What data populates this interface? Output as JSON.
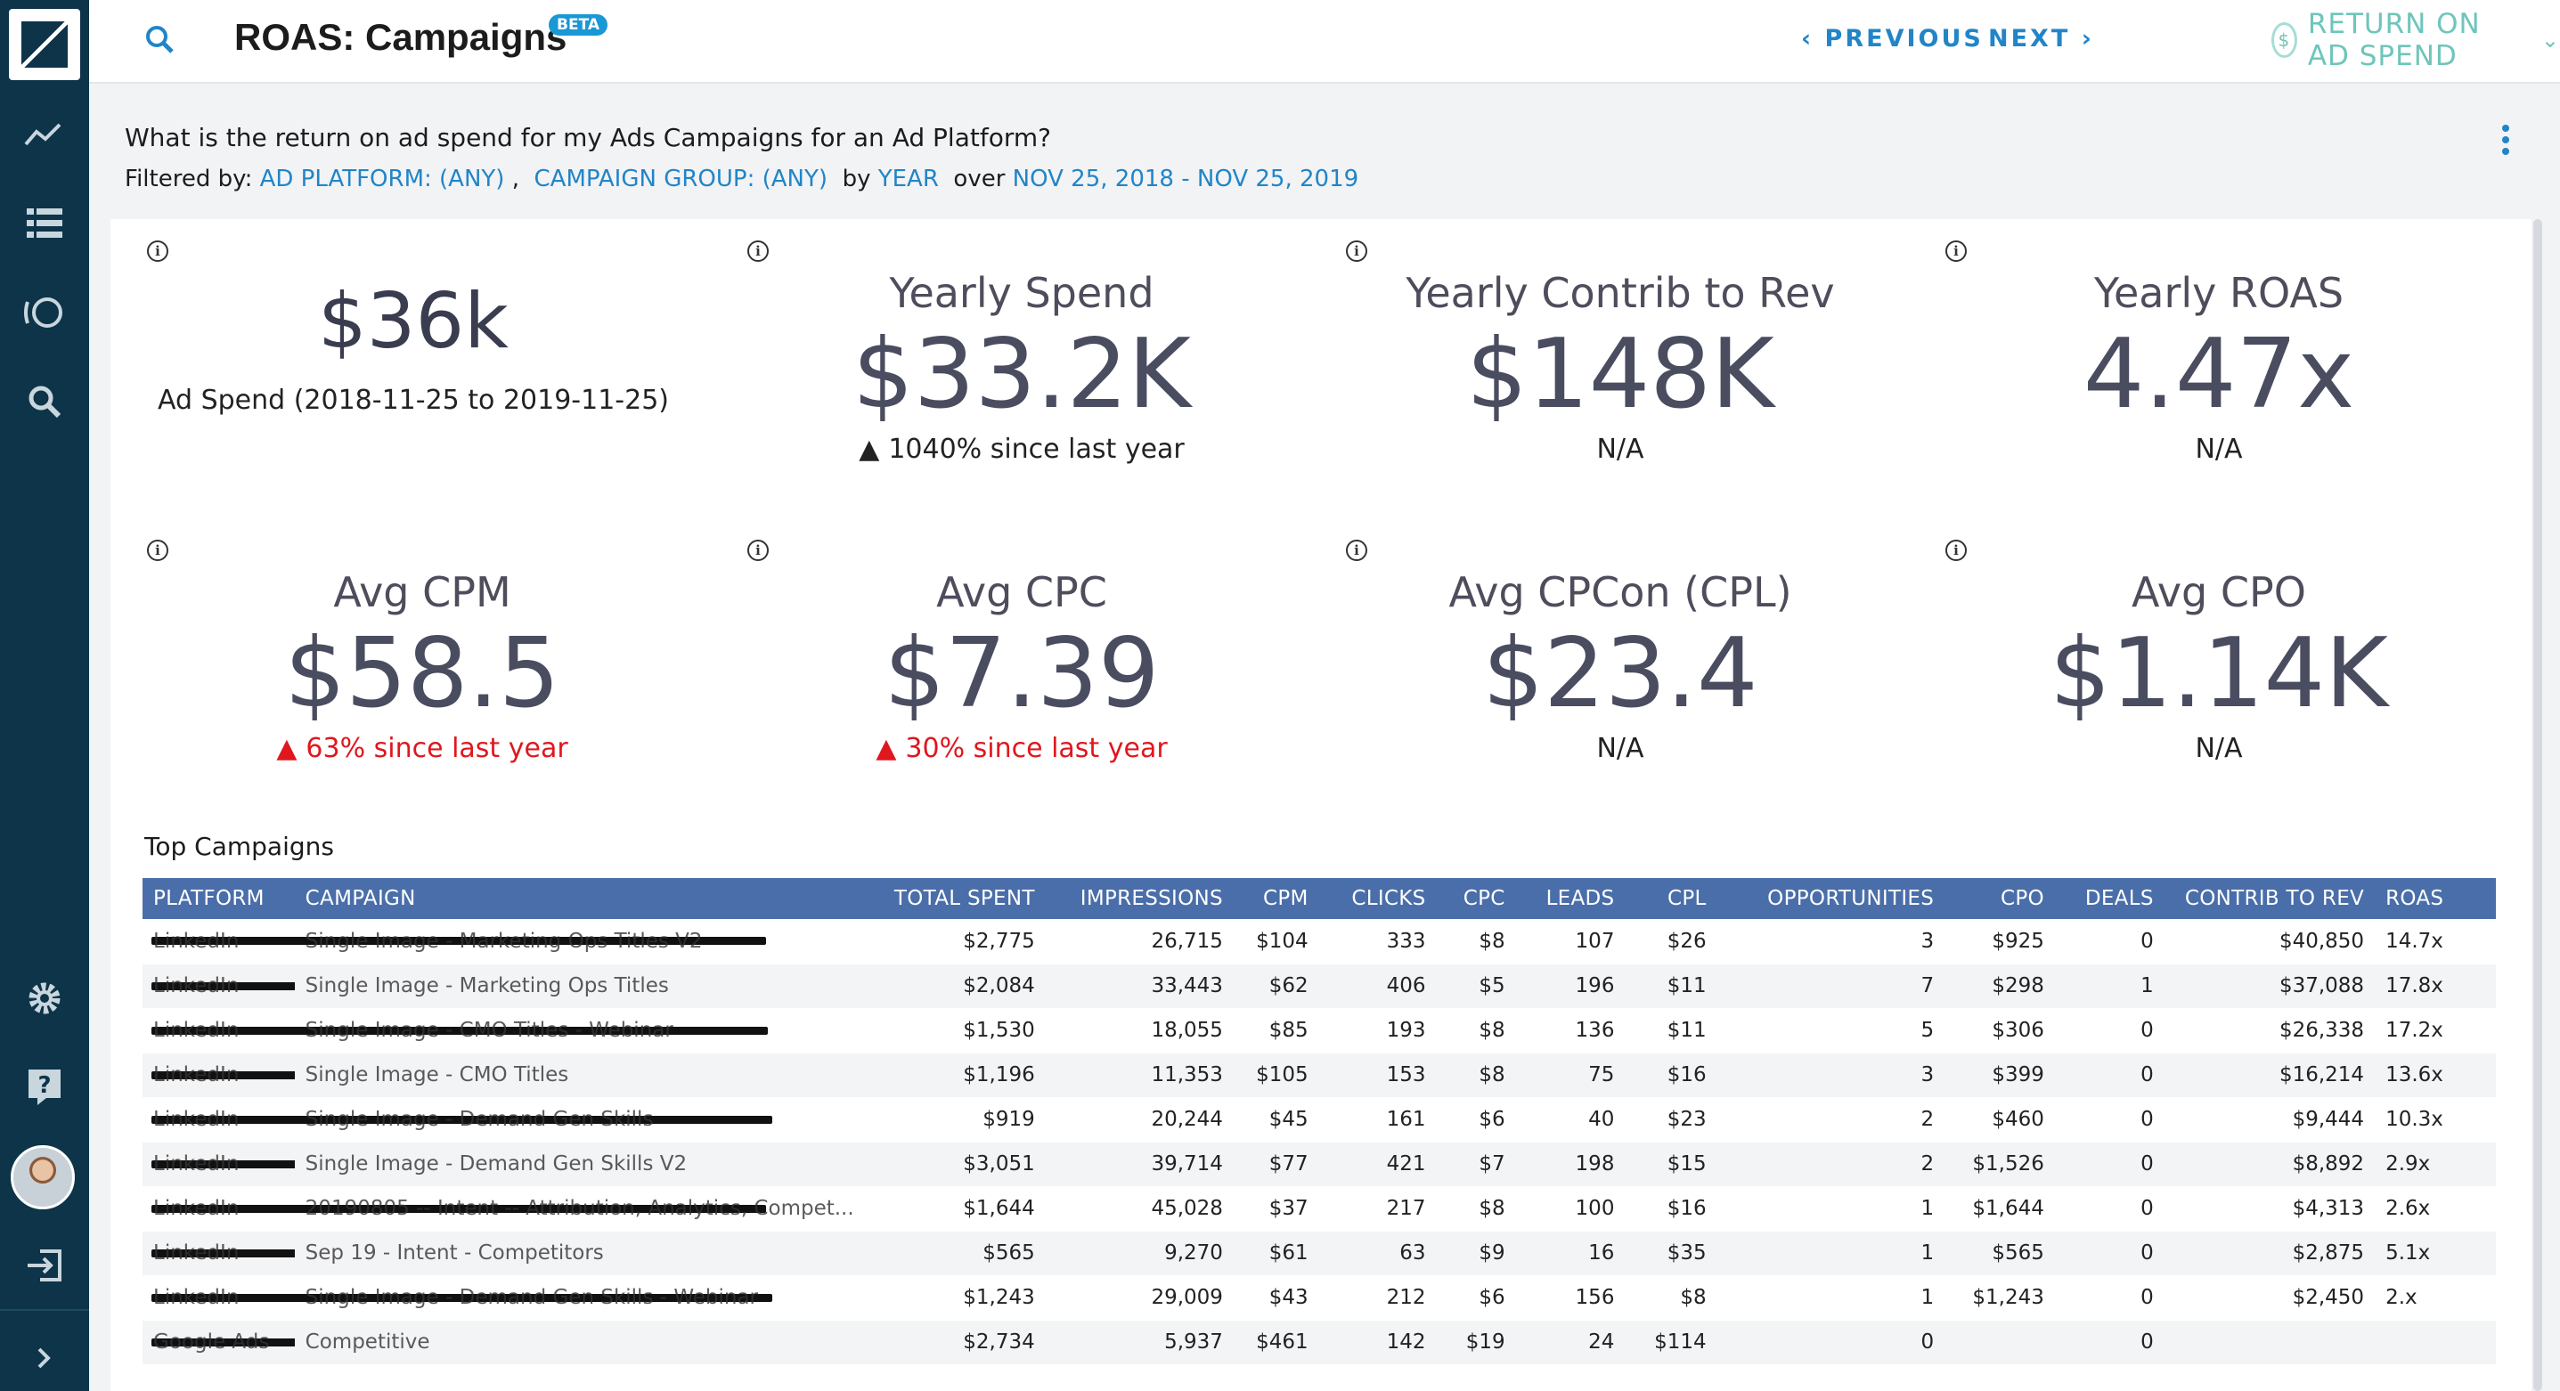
{
  "header": {
    "title": "ROAS: Campaigns",
    "badge": "BETA",
    "prev_label": "PREVIOUS",
    "next_label": "NEXT",
    "menu_label": "RETURN ON AD SPEND",
    "coin_symbol": "$"
  },
  "question": "What is the return on ad spend for my Ads Campaigns for an Ad Platform?",
  "filters": {
    "prefix": "Filtered by:",
    "platform": "AD PLATFORM: (ANY)",
    "sep": ",",
    "group": "CAMPAIGN GROUP: (ANY)",
    "by": "by",
    "period": "YEAR",
    "over": "over",
    "range": "NOV 25, 2018 - NOV 25, 2019"
  },
  "cards": [
    {
      "title": "",
      "value": "$36k",
      "sub": "Ad Spend (2018-11-25 to 2019-11-25)"
    },
    {
      "title": "Yearly Spend",
      "value": "$33.2K",
      "sub": "1040% since last year"
    },
    {
      "title": "Yearly Contrib to Rev",
      "value": "$148K",
      "sub": "N/A"
    },
    {
      "title": "Yearly ROAS",
      "value": "4.47x",
      "sub": "N/A"
    },
    {
      "title": "Avg CPM",
      "value": "$58.5",
      "sub": "63% since last year"
    },
    {
      "title": "Avg CPC",
      "value": "$7.39",
      "sub": "30% since last year"
    },
    {
      "title": "Avg CPCon (CPL)",
      "value": "$23.4",
      "sub": "N/A"
    },
    {
      "title": "Avg CPO",
      "value": "$1.14K",
      "sub": "N/A"
    }
  ],
  "info_glyph": "i",
  "table": {
    "title": "Top Campaigns",
    "columns": [
      "PLATFORM",
      "CAMPAIGN",
      "TOTAL SPENT",
      "IMPRESSIONS",
      "CPM",
      "CLICKS",
      "CPC",
      "LEADS",
      "CPL",
      "OPPORTUNITIES",
      "CPO",
      "DEALS",
      "CONTRIB TO REV",
      "ROAS"
    ],
    "rows": [
      [
        "LinkedIn",
        "Single Image - Marketing Ops Titles V2",
        "$2,775",
        "26,715",
        "$104",
        "333",
        "$8",
        "107",
        "$26",
        "3",
        "$925",
        "0",
        "$40,850",
        "14.7x"
      ],
      [
        "LinkedIn",
        "Single Image - Marketing Ops Titles",
        "$2,084",
        "33,443",
        "$62",
        "406",
        "$5",
        "196",
        "$11",
        "7",
        "$298",
        "1",
        "$37,088",
        "17.8x"
      ],
      [
        "LinkedIn",
        "Single Image - CMO Titles - Webinar",
        "$1,530",
        "18,055",
        "$85",
        "193",
        "$8",
        "136",
        "$11",
        "5",
        "$306",
        "0",
        "$26,338",
        "17.2x"
      ],
      [
        "LinkedIn",
        "Single Image - CMO Titles",
        "$1,196",
        "11,353",
        "$105",
        "153",
        "$8",
        "75",
        "$16",
        "3",
        "$399",
        "0",
        "$16,214",
        "13.6x"
      ],
      [
        "LinkedIn",
        "Single Image - Demand Gen Skills",
        "$919",
        "20,244",
        "$45",
        "161",
        "$6",
        "40",
        "$23",
        "2",
        "$460",
        "0",
        "$9,444",
        "10.3x"
      ],
      [
        "LinkedIn",
        "Single Image - Demand Gen Skills V2",
        "$3,051",
        "39,714",
        "$77",
        "421",
        "$7",
        "198",
        "$15",
        "2",
        "$1,526",
        "0",
        "$8,892",
        "2.9x"
      ],
      [
        "LinkedIn",
        "20190805 -- Intent -- Attribution, Analytics, Compet...",
        "$1,644",
        "45,028",
        "$37",
        "217",
        "$8",
        "100",
        "$16",
        "1",
        "$1,644",
        "0",
        "$4,313",
        "2.6x"
      ],
      [
        "LinkedIn",
        "Sep 19 - Intent - Competitors",
        "$565",
        "9,270",
        "$61",
        "63",
        "$9",
        "16",
        "$35",
        "1",
        "$565",
        "0",
        "$2,875",
        "5.1x"
      ],
      [
        "LinkedIn",
        "Single Image - Demand Gen Skills - Webinar",
        "$1,243",
        "29,009",
        "$43",
        "212",
        "$6",
        "156",
        "$8",
        "1",
        "$1,243",
        "0",
        "$2,450",
        "2.x"
      ],
      [
        "Google Ads",
        "Competitive",
        "$2,734",
        "5,937",
        "$461",
        "142",
        "$19",
        "24",
        "$114",
        "0",
        "",
        "0",
        "",
        ""
      ]
    ]
  }
}
